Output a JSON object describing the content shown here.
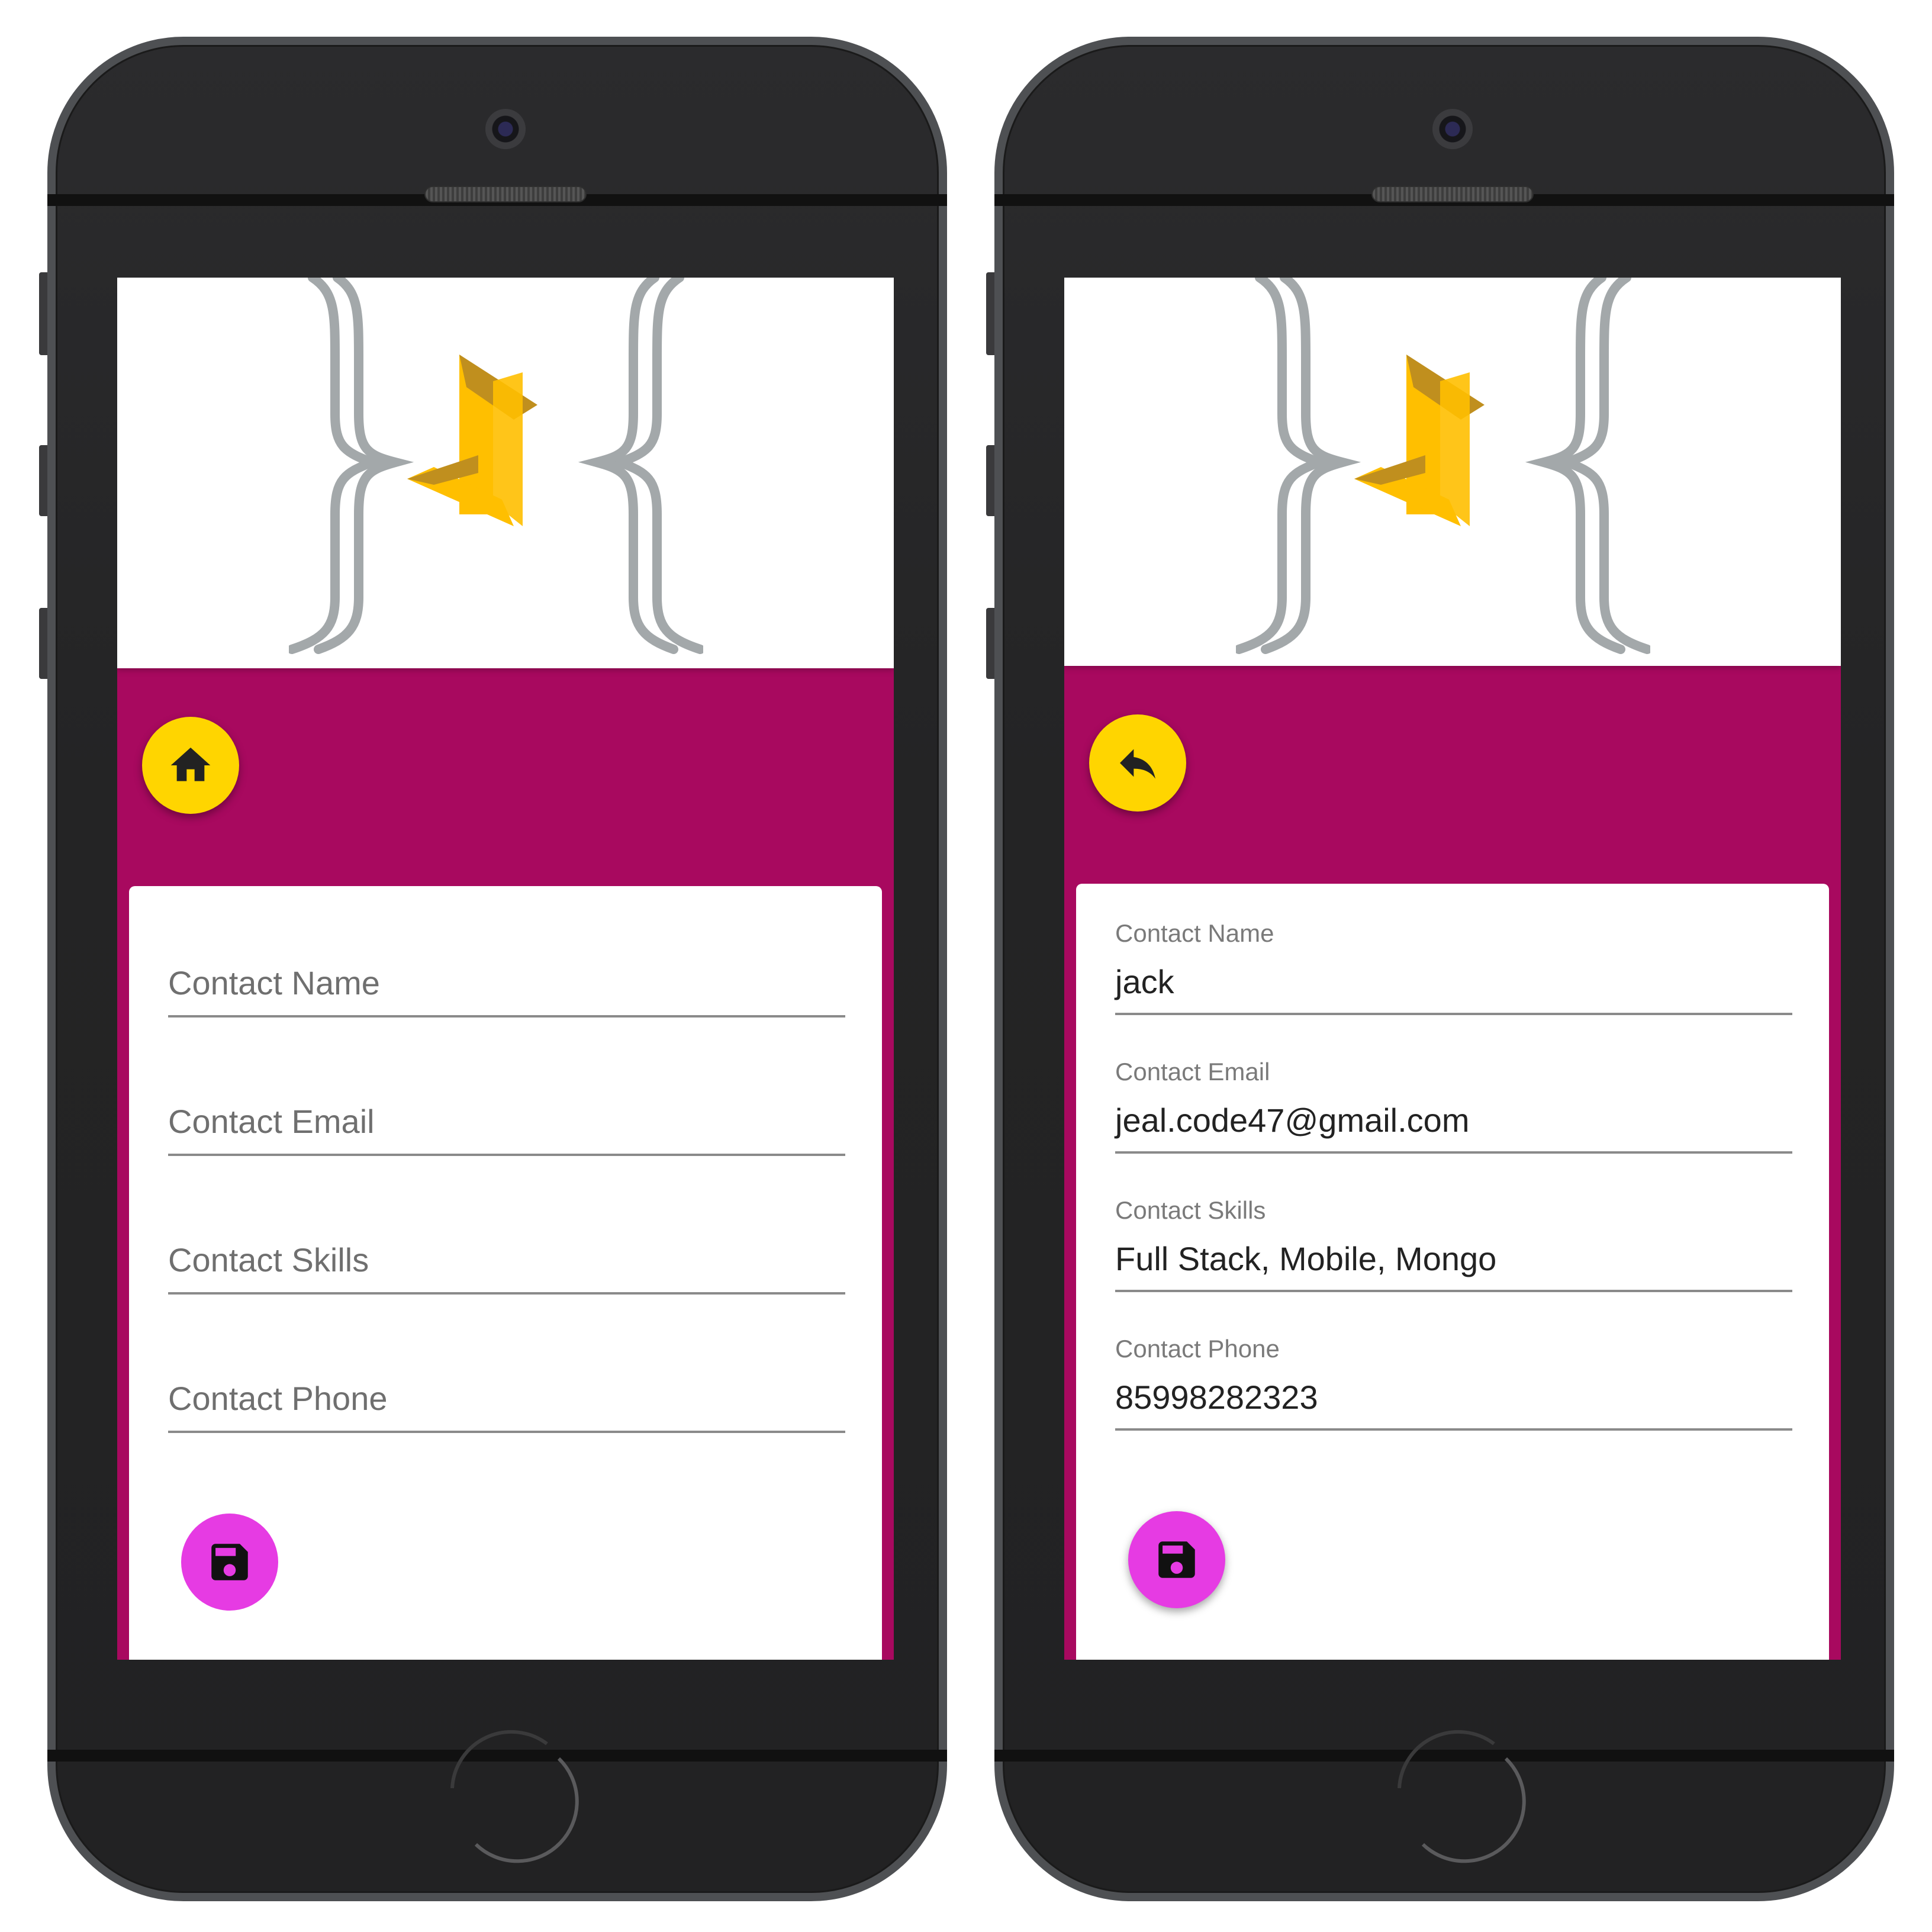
{
  "screens": [
    {
      "nav_button_icon": "home-icon",
      "fields": [
        {
          "placeholder": "Contact Name"
        },
        {
          "placeholder": "Contact Email"
        },
        {
          "placeholder": "Contact Skills"
        },
        {
          "placeholder": "Contact Phone"
        }
      ],
      "save_button_icon": "save-icon"
    },
    {
      "nav_button_icon": "reply-icon",
      "fields": [
        {
          "label": "Contact Name",
          "value": "jack"
        },
        {
          "label": "Contact Email",
          "value": "jeal.code47@gmail.com"
        },
        {
          "label": "Contact Skills",
          "value": "Full Stack, Mobile, Mongo"
        },
        {
          "label": "Contact Phone",
          "value": "85998282323"
        }
      ],
      "save_button_icon": "save-icon"
    }
  ],
  "colors": {
    "app_bar": "#a8095f",
    "nav_fab": "#ffd500",
    "save_fab": "#e63be3",
    "logo_gray": "#a3a8aa",
    "logo_gold": "#ffbf00",
    "logo_dark_gold": "#c08f1e"
  }
}
